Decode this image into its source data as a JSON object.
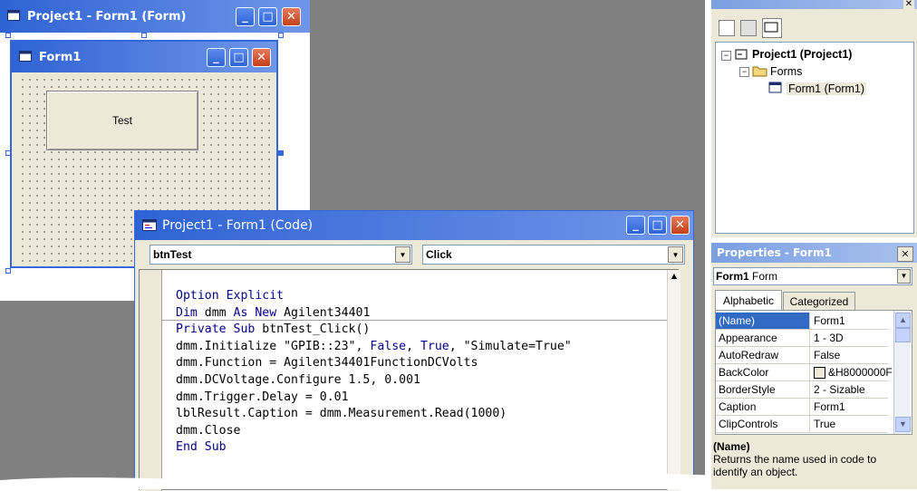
{
  "form_designer": {
    "title": "Project1 - Form1 (Form)",
    "form": {
      "title": "Form1",
      "button_label": "Test"
    }
  },
  "code_window": {
    "title": "Project1 - Form1 (Code)",
    "object_combo": "btnTest",
    "procedure_combo": "Click",
    "lines": [
      {
        "parts": [
          {
            "t": "Option Explicit",
            "k": true
          }
        ]
      },
      {
        "parts": [
          {
            "t": "Dim",
            "k": true
          },
          {
            "t": " dmm ",
            "k": false
          },
          {
            "t": "As New",
            "k": true
          },
          {
            "t": " Agilent34401",
            "k": false
          }
        ]
      },
      {
        "parts": [
          {
            "t": "Private Sub",
            "k": true
          },
          {
            "t": " btnTest_Click()",
            "k": false
          }
        ]
      },
      {
        "parts": [
          {
            "t": "dmm.Initialize \"GPIB::23\", ",
            "k": false
          },
          {
            "t": "False",
            "k": true
          },
          {
            "t": ", ",
            "k": false
          },
          {
            "t": "True",
            "k": true
          },
          {
            "t": ", \"Simulate=True\"",
            "k": false
          }
        ]
      },
      {
        "parts": [
          {
            "t": "dmm.Function = Agilent34401FunctionDCVolts",
            "k": false
          }
        ]
      },
      {
        "parts": [
          {
            "t": "dmm.DCVoltage.Configure 1.5, 0.001",
            "k": false
          }
        ]
      },
      {
        "parts": [
          {
            "t": "dmm.Trigger.Delay = 0.01",
            "k": false
          }
        ]
      },
      {
        "parts": [
          {
            "t": "lblResult.Caption = dmm.Measurement.Read(1000)",
            "k": false
          }
        ]
      },
      {
        "parts": [
          {
            "t": "dmm.Close",
            "k": false
          }
        ]
      },
      {
        "parts": [
          {
            "t": "End Sub",
            "k": true
          }
        ]
      }
    ]
  },
  "project_explorer": {
    "root": "Project1 (Project1)",
    "folder": "Forms",
    "item": "Form1 (Form1)"
  },
  "properties": {
    "title": "Properties - Form1",
    "object_combo_bold": "Form1",
    "object_combo_type": "Form",
    "tabs": [
      "Alphabetic",
      "Categorized"
    ],
    "rows": [
      {
        "name": "(Name)",
        "value": "Form1"
      },
      {
        "name": "Appearance",
        "value": "1 - 3D"
      },
      {
        "name": "AutoRedraw",
        "value": "False"
      },
      {
        "name": "BackColor",
        "value": "&H8000000F"
      },
      {
        "name": "BorderStyle",
        "value": "2 - Sizable"
      },
      {
        "name": "Caption",
        "value": "Form1"
      },
      {
        "name": "ClipControls",
        "value": "True"
      }
    ],
    "desc_title": "(Name)",
    "desc_text": "Returns the name used in code to identify an object.",
    "backcolor_swatch": "#ece9d8"
  },
  "colors": {
    "titlebar": "#2f63d4",
    "keyword": "#00008b",
    "mdi_background": "#808080",
    "selected_row": "#316ac5"
  }
}
